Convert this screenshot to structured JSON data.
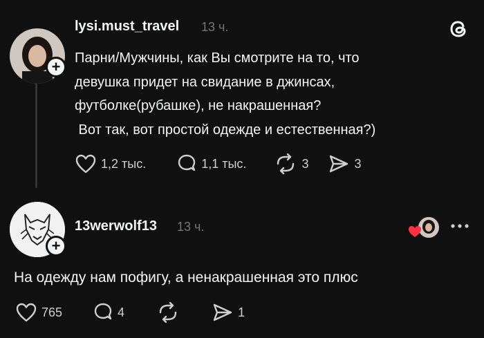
{
  "post": {
    "username": "lysi.must_travel",
    "time": "13 ч.",
    "text_lines": [
      "Парни/Мужчины, как Вы смотрите на то, что",
      "девушка придет на свидание в джинсах,",
      "футболке(рубашке), не накрашенная?",
      " Вот так, вот простой одежде и естественная?)"
    ],
    "likes": "1,2 тыс.",
    "replies": "1,1 тыс.",
    "reposts": "3",
    "shares": "3"
  },
  "reply": {
    "username": "13werwolf13",
    "time": "13 ч.",
    "text": "На одежду нам пофигу, а ненакрашенная это плюс",
    "likes": "765",
    "replies": "4",
    "reposts": "",
    "shares": "1"
  },
  "colors": {
    "background": "#101010",
    "text": "#f3f5f7",
    "muted": "#777777",
    "liked_red": "#ff3040"
  },
  "icons": {
    "follow": "plus-icon",
    "brand": "threads-logo-icon",
    "like": "heart-icon",
    "reply": "comment-icon",
    "repost": "repost-icon",
    "share": "share-icon",
    "more": "more-icon"
  }
}
